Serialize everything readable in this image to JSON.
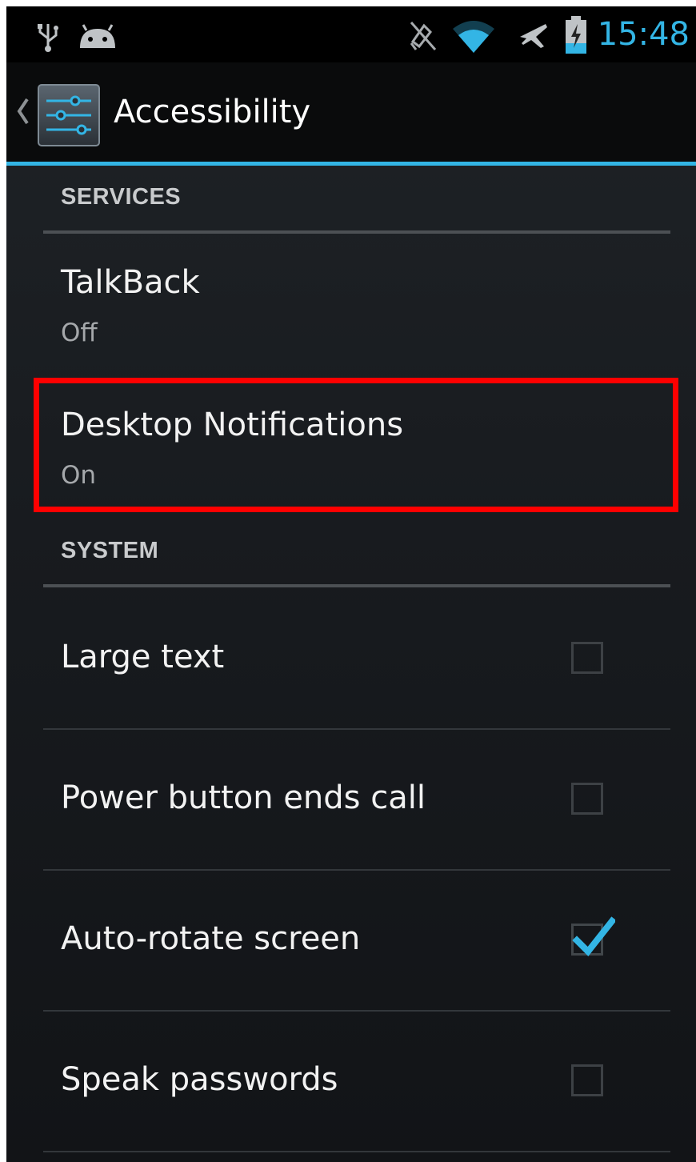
{
  "status_bar": {
    "time": "15:48",
    "icons": [
      "usb-icon",
      "android-debug-icon",
      "mute-icon",
      "wifi-icon",
      "airplane-mode-icon",
      "battery-charging-icon"
    ]
  },
  "action_bar": {
    "title": "Accessibility",
    "icon": "settings-sliders-icon"
  },
  "sections": [
    {
      "header": "SERVICES",
      "items": [
        {
          "title": "TalkBack",
          "summary": "Off"
        },
        {
          "title": "Desktop Notifications",
          "summary": "On",
          "highlighted": true
        }
      ]
    },
    {
      "header": "SYSTEM",
      "items": [
        {
          "title": "Large text",
          "checked": false
        },
        {
          "title": "Power button ends call",
          "checked": false
        },
        {
          "title": "Auto-rotate screen",
          "checked": true
        },
        {
          "title": "Speak passwords",
          "checked": false
        }
      ]
    }
  ],
  "colors": {
    "accent": "#33b5e5",
    "highlight": "#ff0000",
    "background": "#181b1f"
  }
}
